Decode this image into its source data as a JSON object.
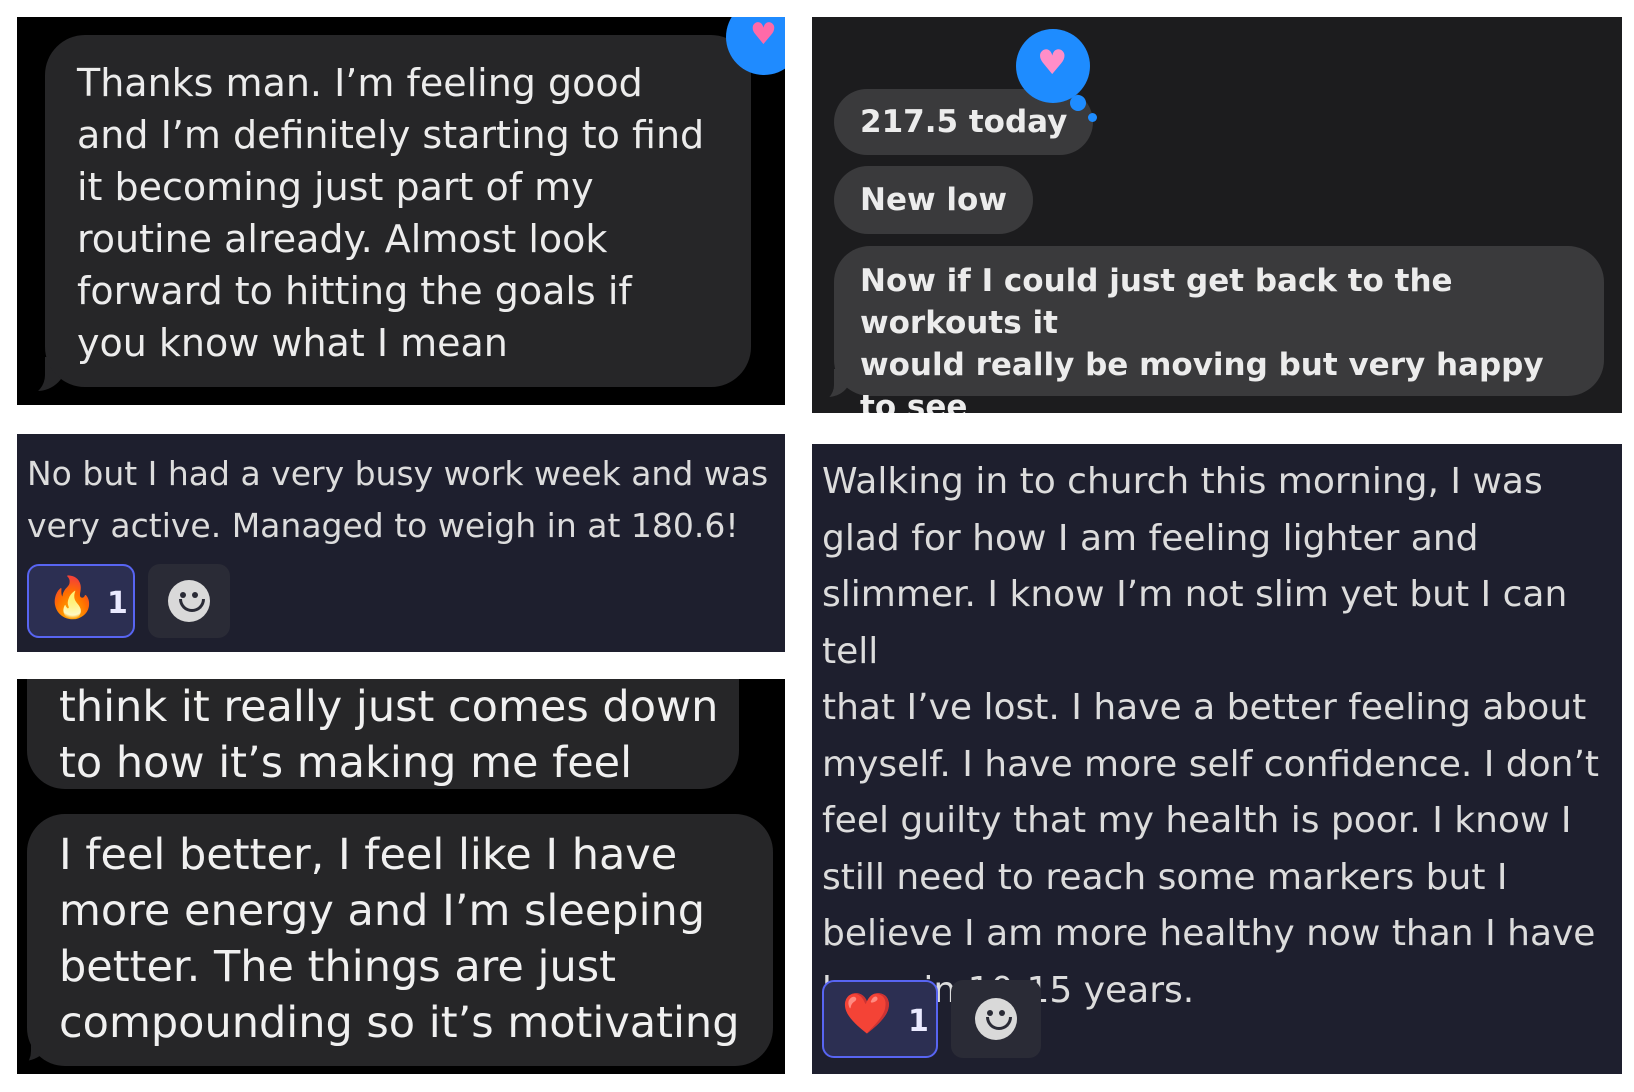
{
  "panel1": {
    "message": "Thanks man. I’m feeling good\nand I’m definitely starting to find\nit becoming just part of my\nroutine already. Almost look\nforward to hitting the goals if\nyou know what I mean",
    "reaction_icon": "heart-icon",
    "reaction_color": "#1f8bff"
  },
  "panel2": {
    "messages": [
      "217.5 today",
      "New low",
      "Now if I could just get back to the workouts it\nwould really be moving but very happy to see\nresults despite"
    ],
    "reaction_icon": "heart-icon",
    "reaction_color": "#1e8cff"
  },
  "panel3": {
    "message": "No but I had a very busy work week and was\nvery active.  Managed to weigh  in at 180.6!",
    "reaction": {
      "emoji": "🔥",
      "icon": "fire-icon",
      "count": "1"
    },
    "add_reaction_icon": "smiley-icon"
  },
  "panel4": {
    "messages": [
      "think it really just comes down\nto how it’s making me feel",
      "I feel better, I feel like I have\nmore energy and I’m sleeping\nbetter. The things are just\ncompounding so it’s motivating"
    ]
  },
  "panel5": {
    "message": "Walking in to church this morning, I was\nglad for how I am feeling lighter and\nslimmer. I know I’m not slim yet but I can tell\nthat I’ve lost. I have a better feeling about\nmyself. I have more self confidence. I don’t\nfeel guilty that my health is poor. I know I\nstill need to reach some markers but I\nbelieve I am more healthy now than I have\nbeen in 10-15 years.",
    "reaction": {
      "emoji": "❤️",
      "icon": "heart-icon",
      "count": "1"
    },
    "add_reaction_icon": "smiley-icon"
  },
  "colors": {
    "imessage_bg": "#000000",
    "bubble_gray": "#262628",
    "discord_bg": "#1e1f2e",
    "reaction_border": "#5865f2"
  }
}
